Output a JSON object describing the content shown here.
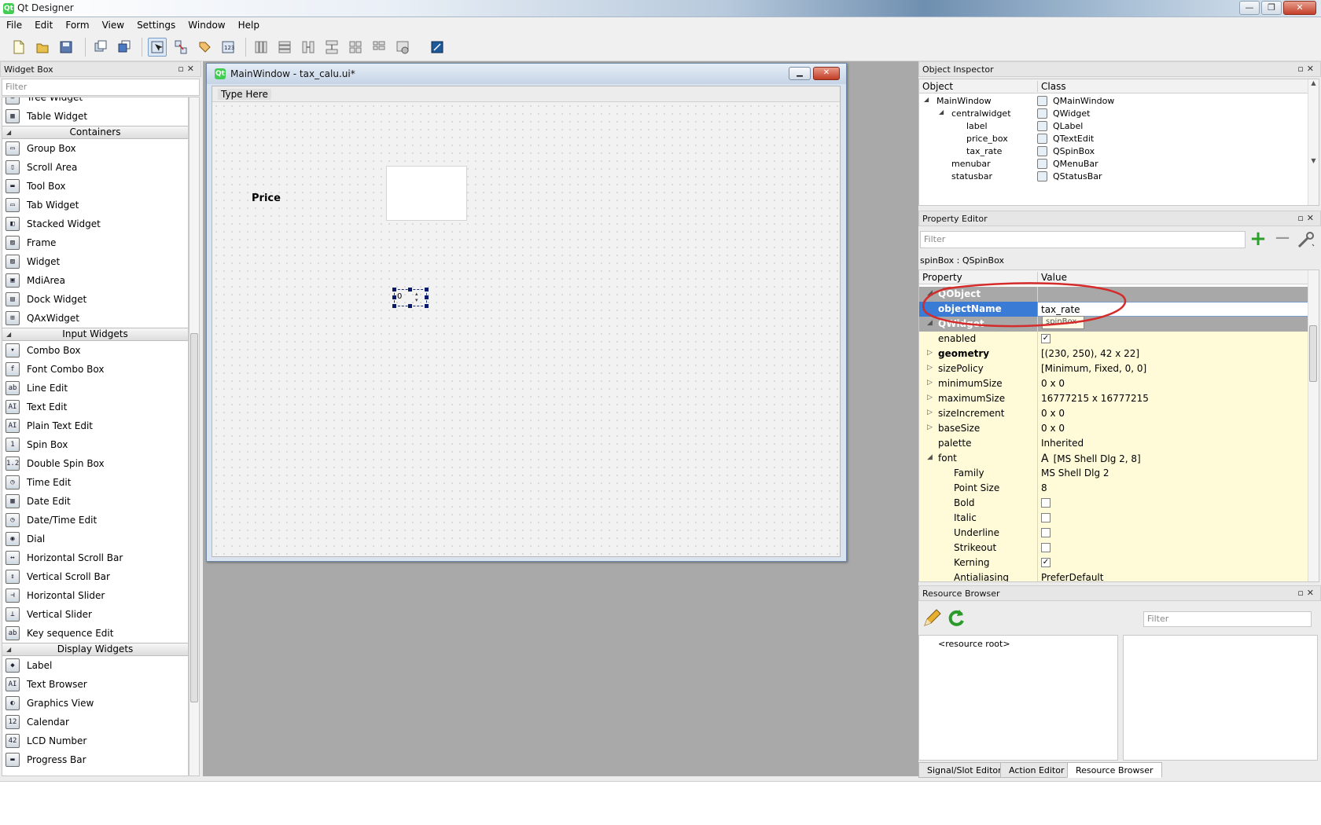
{
  "app": {
    "title": "Qt Designer",
    "menu": [
      "File",
      "Edit",
      "Form",
      "View",
      "Settings",
      "Window",
      "Help"
    ],
    "window_buttons": [
      "—",
      "❐",
      "✕"
    ]
  },
  "widget_box": {
    "title": "Widget Box",
    "filter_placeholder": "Filter",
    "sections": [
      {
        "header": "",
        "items": [
          {
            "label": "Tree Widget",
            "icon": "tree-widget-icon",
            "glyph": "≡"
          },
          {
            "label": "Table Widget",
            "icon": "table-widget-icon",
            "glyph": "▦"
          }
        ]
      },
      {
        "header": "Containers",
        "items": [
          {
            "label": "Group Box",
            "icon": "group-box-icon",
            "glyph": "▭"
          },
          {
            "label": "Scroll Area",
            "icon": "scroll-area-icon",
            "glyph": "▯"
          },
          {
            "label": "Tool Box",
            "icon": "tool-box-icon",
            "glyph": "▬"
          },
          {
            "label": "Tab Widget",
            "icon": "tab-widget-icon",
            "glyph": "▭"
          },
          {
            "label": "Stacked Widget",
            "icon": "stacked-widget-icon",
            "glyph": "◧"
          },
          {
            "label": "Frame",
            "icon": "frame-icon",
            "glyph": "▨"
          },
          {
            "label": "Widget",
            "icon": "widget-icon",
            "glyph": "▨"
          },
          {
            "label": "MdiArea",
            "icon": "mdi-area-icon",
            "glyph": "▣"
          },
          {
            "label": "Dock Widget",
            "icon": "dock-widget-icon",
            "glyph": "▤"
          },
          {
            "label": "QAxWidget",
            "icon": "qaxwidget-icon",
            "glyph": "⊞"
          }
        ]
      },
      {
        "header": "Input Widgets",
        "items": [
          {
            "label": "Combo Box",
            "icon": "combo-box-icon",
            "glyph": "▾"
          },
          {
            "label": "Font Combo Box",
            "icon": "font-combo-box-icon",
            "glyph": "f"
          },
          {
            "label": "Line Edit",
            "icon": "line-edit-icon",
            "glyph": "ab"
          },
          {
            "label": "Text Edit",
            "icon": "text-edit-icon",
            "glyph": "AI"
          },
          {
            "label": "Plain Text Edit",
            "icon": "plain-text-edit-icon",
            "glyph": "AI"
          },
          {
            "label": "Spin Box",
            "icon": "spin-box-icon",
            "glyph": "1"
          },
          {
            "label": "Double Spin Box",
            "icon": "double-spin-box-icon",
            "glyph": "1.2"
          },
          {
            "label": "Time Edit",
            "icon": "time-edit-icon",
            "glyph": "◷"
          },
          {
            "label": "Date Edit",
            "icon": "date-edit-icon",
            "glyph": "▦"
          },
          {
            "label": "Date/Time Edit",
            "icon": "date-time-edit-icon",
            "glyph": "◷"
          },
          {
            "label": "Dial",
            "icon": "dial-icon",
            "glyph": "◉"
          },
          {
            "label": "Horizontal Scroll Bar",
            "icon": "horizontal-scroll-bar-icon",
            "glyph": "↔"
          },
          {
            "label": "Vertical Scroll Bar",
            "icon": "vertical-scroll-bar-icon",
            "glyph": "↕"
          },
          {
            "label": "Horizontal Slider",
            "icon": "horizontal-slider-icon",
            "glyph": "⊣"
          },
          {
            "label": "Vertical Slider",
            "icon": "vertical-slider-icon",
            "glyph": "⊥"
          },
          {
            "label": "Key sequence Edit",
            "icon": "key-sequence-edit-icon",
            "glyph": "ab"
          }
        ]
      },
      {
        "header": "Display Widgets",
        "items": [
          {
            "label": "Label",
            "icon": "label-icon",
            "glyph": "◆"
          },
          {
            "label": "Text Browser",
            "icon": "text-browser-icon",
            "glyph": "AI"
          },
          {
            "label": "Graphics View",
            "icon": "graphics-view-icon",
            "glyph": "◐"
          },
          {
            "label": "Calendar",
            "icon": "calendar-icon",
            "glyph": "12"
          },
          {
            "label": "LCD Number",
            "icon": "lcd-number-icon",
            "glyph": "42"
          },
          {
            "label": "Progress Bar",
            "icon": "progress-bar-icon",
            "glyph": "▬"
          }
        ]
      }
    ]
  },
  "form": {
    "window_title": "MainWindow - tax_calu.ui*",
    "menu_placeholder": "Type Here",
    "price_label": "Price",
    "spinbox_value": "0"
  },
  "object_inspector": {
    "title": "Object Inspector",
    "columns": [
      "Object",
      "Class"
    ],
    "rows": [
      {
        "object": "MainWindow",
        "class": "QMainWindow",
        "depth": 0,
        "expander": "◢"
      },
      {
        "object": "centralwidget",
        "class": "QWidget",
        "depth": 1,
        "expander": "◢"
      },
      {
        "object": "label",
        "class": "QLabel",
        "depth": 2,
        "expander": ""
      },
      {
        "object": "price_box",
        "class": "QTextEdit",
        "depth": 2,
        "expander": ""
      },
      {
        "object": "tax_rate",
        "class": "QSpinBox",
        "depth": 2,
        "expander": ""
      },
      {
        "object": "menubar",
        "class": "QMenuBar",
        "depth": 1,
        "expander": ""
      },
      {
        "object": "statusbar",
        "class": "QStatusBar",
        "depth": 1,
        "expander": ""
      }
    ]
  },
  "property_editor": {
    "title": "Property Editor",
    "filter_placeholder": "Filter",
    "object_label": "spinBox : QSpinBox",
    "columns": [
      "Property",
      "Value"
    ],
    "tooltip": "spinBox",
    "rows": [
      {
        "kind": "group",
        "name": "QObject",
        "value": "",
        "expander": "◢"
      },
      {
        "kind": "edit",
        "name": "objectName",
        "value": "tax_rate",
        "expander": ""
      },
      {
        "kind": "group",
        "name": "QWidget",
        "value": "",
        "expander": "◢"
      },
      {
        "kind": "check",
        "name": "enabled",
        "value": "✓",
        "expander": ""
      },
      {
        "kind": "prop",
        "name": "geometry",
        "value": "[(230, 250), 42 x 22]",
        "expander": "▷",
        "bold": true
      },
      {
        "kind": "prop",
        "name": "sizePolicy",
        "value": "[Minimum, Fixed, 0, 0]",
        "expander": "▷"
      },
      {
        "kind": "prop",
        "name": "minimumSize",
        "value": "0 x 0",
        "expander": "▷"
      },
      {
        "kind": "prop",
        "name": "maximumSize",
        "value": "16777215 x 16777215",
        "expander": "▷"
      },
      {
        "kind": "prop",
        "name": "sizeIncrement",
        "value": "0 x 0",
        "expander": "▷"
      },
      {
        "kind": "prop",
        "name": "baseSize",
        "value": "0 x 0",
        "expander": "▷"
      },
      {
        "kind": "prop",
        "name": "palette",
        "value": "Inherited",
        "expander": ""
      },
      {
        "kind": "prop",
        "name": "font",
        "value": "[MS Shell Dlg 2, 8]",
        "expander": "◢",
        "font_glyph": "A"
      },
      {
        "kind": "sub",
        "name": "Family",
        "value": "MS Shell Dlg 2",
        "expander": ""
      },
      {
        "kind": "sub",
        "name": "Point Size",
        "value": "8",
        "expander": ""
      },
      {
        "kind": "subcheck",
        "name": "Bold",
        "value": "",
        "expander": ""
      },
      {
        "kind": "subcheck",
        "name": "Italic",
        "value": "",
        "expander": ""
      },
      {
        "kind": "subcheck",
        "name": "Underline",
        "value": "",
        "expander": ""
      },
      {
        "kind": "subcheck",
        "name": "Strikeout",
        "value": "",
        "expander": ""
      },
      {
        "kind": "subcheck",
        "name": "Kerning",
        "value": "✓",
        "expander": ""
      },
      {
        "kind": "sub",
        "name": "Antialiasing",
        "value": "PreferDefault",
        "expander": ""
      }
    ]
  },
  "resource_browser": {
    "title": "Resource Browser",
    "filter_placeholder": "Filter",
    "root": "<resource root>"
  },
  "bottom_tabs": [
    "Signal/Slot Editor",
    "Action Editor",
    "Resource Browser"
  ],
  "colors": {
    "highlight": "#3a7bd5",
    "annotation": "#d42b2b",
    "group_row": "#a8a8a8",
    "yellow_row": "#fffbd9"
  }
}
